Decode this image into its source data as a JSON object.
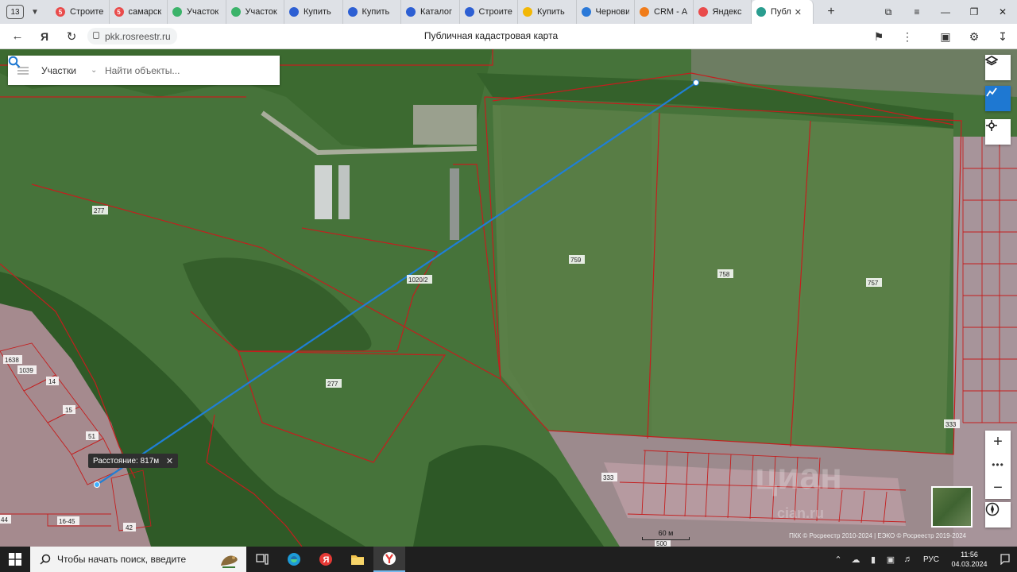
{
  "browser": {
    "tab_count": "13",
    "tabs": [
      {
        "label": "Строите",
        "color": "#e94b4b",
        "glyph": "5"
      },
      {
        "label": "самарск",
        "color": "#e94b4b",
        "glyph": "5"
      },
      {
        "label": "Участок",
        "color": "#3bb36a",
        "glyph": ""
      },
      {
        "label": "Участок",
        "color": "#3bb36a",
        "glyph": ""
      },
      {
        "label": "Купить",
        "color": "#2d5fd3",
        "glyph": ""
      },
      {
        "label": "Купить",
        "color": "#2d5fd3",
        "glyph": ""
      },
      {
        "label": "Каталог",
        "color": "#2d5fd3",
        "glyph": ""
      },
      {
        "label": "Строите",
        "color": "#2d5fd3",
        "glyph": ""
      },
      {
        "label": "Купить",
        "color": "#f2b705",
        "glyph": ""
      },
      {
        "label": "Черновик",
        "color": "#2b79d8",
        "glyph": ""
      },
      {
        "label": "CRM - А",
        "color": "#f07c1a",
        "glyph": ""
      },
      {
        "label": "Яндекс",
        "color": "#e94b4b",
        "glyph": ""
      }
    ],
    "active_tab": {
      "label": "Публ",
      "color": "#2a9d8f"
    },
    "url": "pkk.rosreestr.ru",
    "page_title": "Публичная кадастровая карта"
  },
  "map": {
    "search": {
      "layer_label": "Участки",
      "placeholder": "Найти объекты..."
    },
    "parcel_labels": {
      "p277a": "277",
      "p277b": "277",
      "p1020": "1020/2",
      "p759": "759",
      "p758": "758",
      "p757": "757",
      "p333a": "333",
      "p333b": "333",
      "p14": "14",
      "p15": "15",
      "p51": "51",
      "p1638": "1638",
      "p1039": "1039",
      "p42": "42",
      "p1645": "16-45",
      "p44": "44",
      "p500": "500"
    },
    "measure_tooltip": "Расстояние: 817м",
    "scale_label": "60 м",
    "attribution": "ПКК © Росреестр 2010-2024 | ЕЭКО © Росреестр 2019-2024",
    "watermark": "циан",
    "watermark_sub": "cian.ru"
  },
  "taskbar": {
    "search_placeholder": "Чтобы начать поиск, введите",
    "lang": "РУС",
    "time": "11:56",
    "date": "04.03.2024"
  }
}
